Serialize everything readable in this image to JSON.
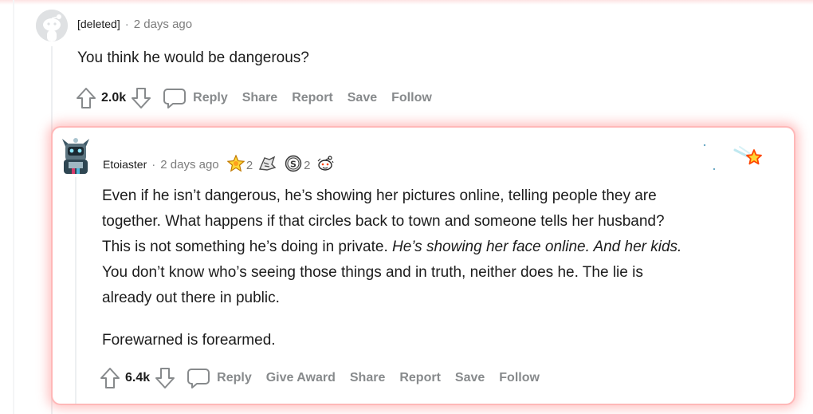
{
  "parent": {
    "username": "[deleted]",
    "separator": "·",
    "timestamp": "2 days ago",
    "body": "You think he would be dangerous?",
    "votes": "2.0k",
    "actions": [
      "Reply",
      "Share",
      "Report",
      "Save",
      "Follow"
    ]
  },
  "reply": {
    "username": "Etoiaster",
    "separator": "·",
    "timestamp": "2 days ago",
    "awards": [
      {
        "icon": "star-award-icon",
        "count": "2"
      },
      {
        "icon": "helpful-award-icon",
        "count": ""
      },
      {
        "icon": "silver-award-icon",
        "count": "2"
      },
      {
        "icon": "wholesome-snoo-award-icon",
        "count": ""
      }
    ],
    "paragraph1_line1": "Even if he isn’t dangerous, he’s showing her pictures online, telling people they are",
    "paragraph1_line2": "together. What happens if that circles back to town and someone tells her husband?",
    "paragraph1_line3_plain": "This is not something he’s doing in private. ",
    "paragraph1_line3_italic": "He’s showing her face online. And her kids.",
    "paragraph1_line4": "You don’t know who’s seeing those things and in truth, neither does he. The lie is",
    "paragraph1_line5": "already out there in public.",
    "paragraph2": "Forewarned is forearmed.",
    "votes": "6.4k",
    "actions": [
      "Reply",
      "Give Award",
      "Share",
      "Report",
      "Save",
      "Follow"
    ]
  },
  "colors": {
    "highlight_glow": "#ff7878",
    "text_primary": "#1c1c1c",
    "text_meta": "#7c7c7c",
    "action_gray": "#878a8c"
  }
}
